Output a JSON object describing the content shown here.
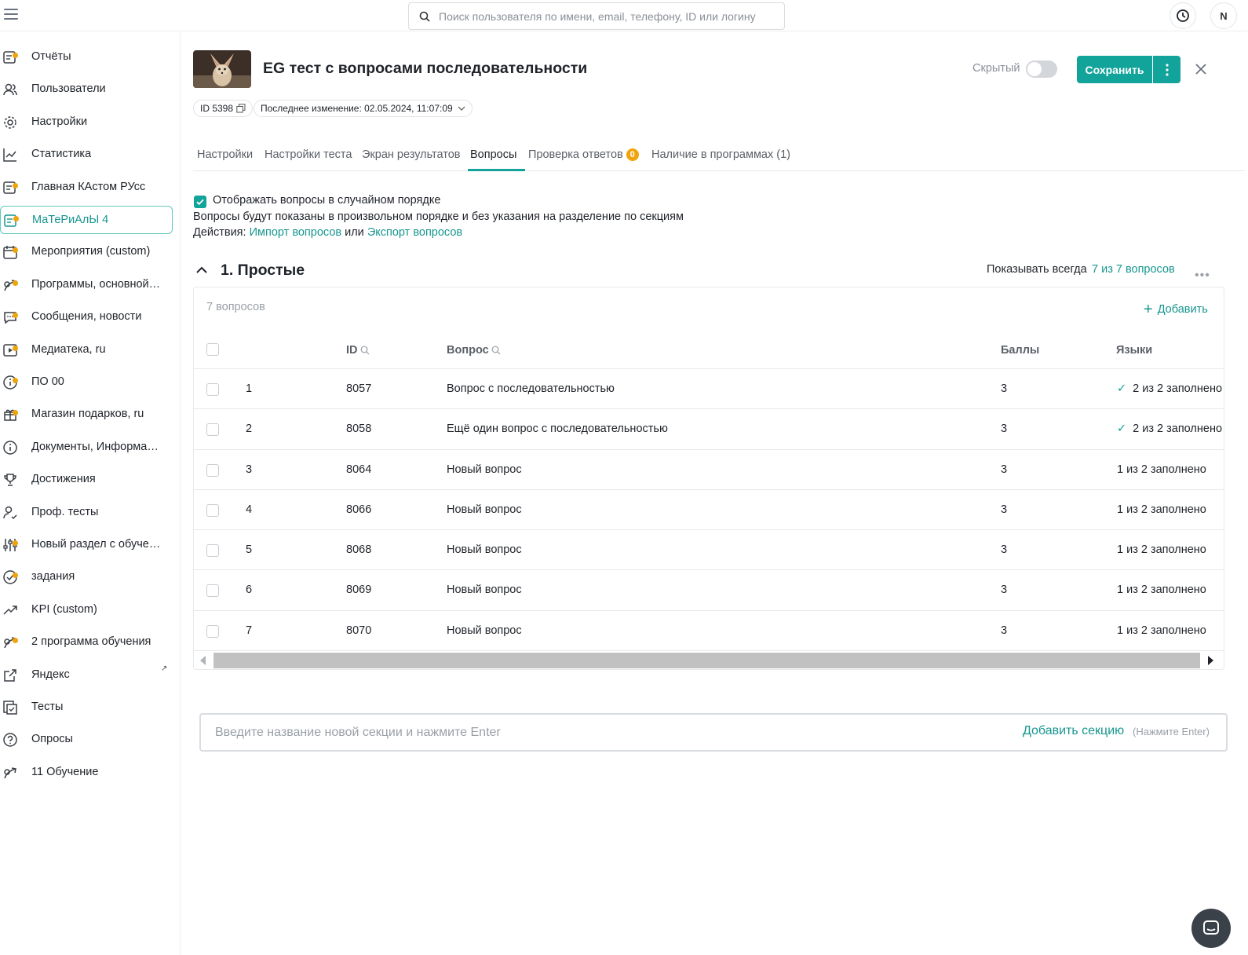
{
  "search": {
    "placeholder": "Поиск пользователя по имени, email, телефону, ID или логину"
  },
  "user": {
    "initial": "N"
  },
  "sidebar": {
    "items": [
      {
        "label": "Отчёты",
        "icon": "reports-icon",
        "dot": true
      },
      {
        "label": "Пользователи",
        "icon": "users-icon",
        "dot": false
      },
      {
        "label": "Настройки",
        "icon": "gear-icon",
        "dot": false
      },
      {
        "label": "Статистика",
        "icon": "chart-icon",
        "dot": false
      },
      {
        "label": "Главная КАстом РУсс",
        "icon": "page-icon",
        "dot": true
      },
      {
        "label": "МаТеРиАлЫ 4",
        "icon": "materials-icon",
        "dot": true,
        "active": true
      },
      {
        "label": "Мероприятия (custom)",
        "icon": "calendar-icon",
        "dot": true
      },
      {
        "label": "Программы, основной ...",
        "icon": "program-icon",
        "dot": true
      },
      {
        "label": "Сообщения, новости",
        "icon": "chat-icon",
        "dot": true
      },
      {
        "label": "Медиатека, ru",
        "icon": "media-icon",
        "dot": true
      },
      {
        "label": "ПО 00",
        "icon": "info-icon",
        "dot": true
      },
      {
        "label": "Магазин подарков, ru",
        "icon": "gift-icon",
        "dot": true
      },
      {
        "label": "Документы, Информац...",
        "icon": "info-icon",
        "dot": false
      },
      {
        "label": "Достижения",
        "icon": "trophy-icon",
        "dot": false
      },
      {
        "label": "Проф. тесты",
        "icon": "user-check-icon",
        "dot": false
      },
      {
        "label": "Новый раздел с обучен...",
        "icon": "sliders-icon",
        "dot": true
      },
      {
        "label": "задания",
        "icon": "task-icon",
        "dot": true
      },
      {
        "label": "KPI (custom)",
        "icon": "trend-icon",
        "dot": false
      },
      {
        "label": "2 программа обучения",
        "icon": "program-icon",
        "dot": true
      },
      {
        "label": "Яндекс",
        "icon": "external-link-icon",
        "dot": false,
        "external": "↗"
      },
      {
        "label": "Тесты",
        "icon": "tests-icon",
        "dot": false
      },
      {
        "label": "Опросы",
        "icon": "question-icon",
        "dot": false
      },
      {
        "label": "11 Обучение",
        "icon": "program-icon",
        "dot": false
      }
    ]
  },
  "header": {
    "title": "EG тест с вопросами последовательности",
    "hidden_label": "Скрытый",
    "save_label": "Сохранить",
    "id_chip": "ID 5398",
    "modified": "Последнее изменение: 02.05.2024, 11:07:09"
  },
  "tabs": [
    {
      "label": "Настройки"
    },
    {
      "label": "Настройки теста"
    },
    {
      "label": "Экран результатов"
    },
    {
      "label": "Вопросы",
      "active": true
    },
    {
      "label": "Проверка ответов",
      "badge": "0"
    },
    {
      "label": "Наличие в программах (1)"
    }
  ],
  "options": {
    "random_label": "Отображать вопросы в случайном порядке",
    "hint": "Вопросы будут показаны в произвольном порядке и без указания на разделение по секциям",
    "actions_prefix": "Действия:",
    "import_link": "Импорт вопросов",
    "or": "или",
    "export_link": "Экспорт вопросов"
  },
  "section": {
    "title": "1. Простые",
    "show_label": "Показывать всегда",
    "show_count": "7 из 7 вопросов",
    "more": "•••",
    "q_count": "7 вопросов",
    "add_label": "Добавить"
  },
  "table": {
    "headers": {
      "id": "ID",
      "question": "Вопрос",
      "points": "Баллы",
      "languages": "Языки"
    },
    "rows": [
      {
        "num": "1",
        "id": "8057",
        "question": "Вопрос с последовательностью",
        "points": "3",
        "lang": "2 из 2 заполнено",
        "complete": true
      },
      {
        "num": "2",
        "id": "8058",
        "question": "Ещё один вопрос с последовательностью",
        "points": "3",
        "lang": "2 из 2 заполнено",
        "complete": true
      },
      {
        "num": "3",
        "id": "8064",
        "question": "Новый вопрос",
        "points": "3",
        "lang": "1 из 2 заполнено",
        "complete": false
      },
      {
        "num": "4",
        "id": "8066",
        "question": "Новый вопрос",
        "points": "3",
        "lang": "1 из 2 заполнено",
        "complete": false
      },
      {
        "num": "5",
        "id": "8068",
        "question": "Новый вопрос",
        "points": "3",
        "lang": "1 из 2 заполнено",
        "complete": false
      },
      {
        "num": "6",
        "id": "8069",
        "question": "Новый вопрос",
        "points": "3",
        "lang": "1 из 2 заполнено",
        "complete": false
      },
      {
        "num": "7",
        "id": "8070",
        "question": "Новый вопрос",
        "points": "3",
        "lang": "1 из 2 заполнено",
        "complete": false
      }
    ]
  },
  "new_section": {
    "placeholder": "Введите название новой секции и нажмите Enter",
    "add_label": "Добавить секцию",
    "hint": "(Нажмите Enter)"
  },
  "colors": {
    "accent": "#12a39a",
    "badge": "#f0a30a"
  }
}
